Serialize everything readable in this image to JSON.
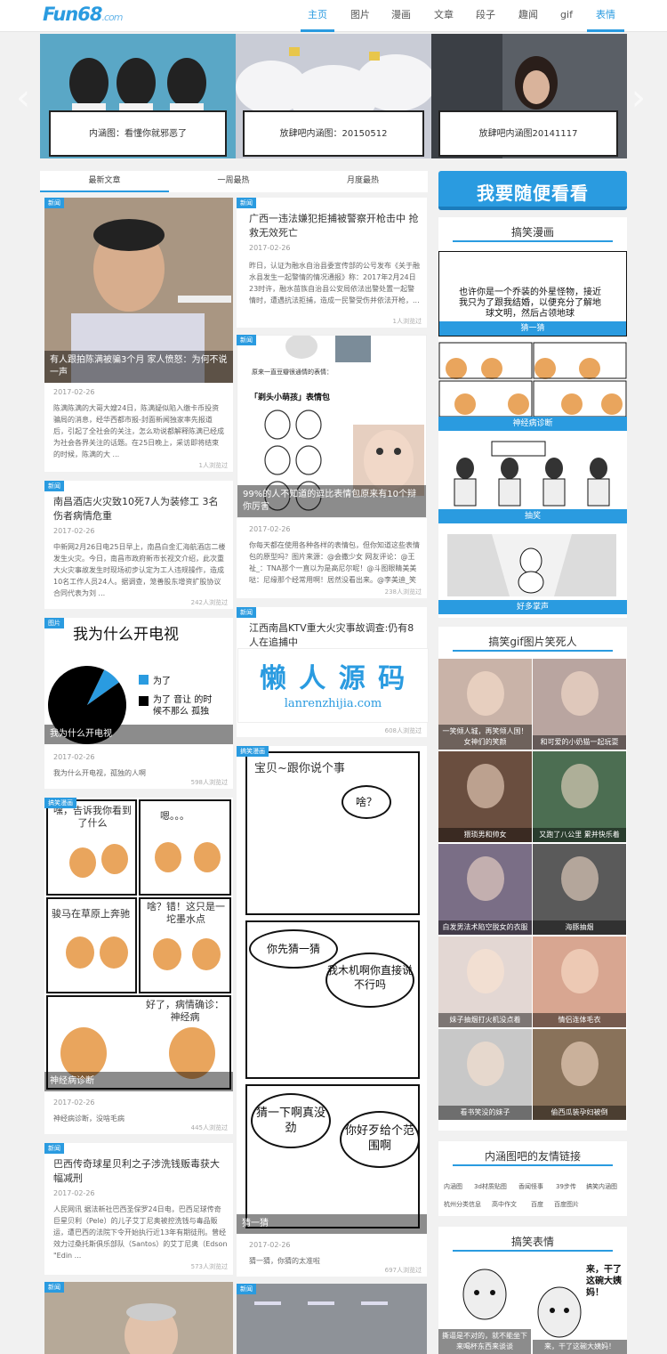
{
  "header": {
    "logo": "Fun68",
    "logo_suffix": ".com",
    "nav": [
      "主页",
      "图片",
      "漫画",
      "文章",
      "段子",
      "趣闻",
      "gif",
      "表情"
    ],
    "active_nav_index": 0
  },
  "slider": {
    "captions": [
      "内涵图：看懂你就邪恶了",
      "放肆吧内涵图：20150512",
      "放肆吧内涵图20141117"
    ]
  },
  "tabs": [
    "最新文章",
    "一周最热",
    "月度最热"
  ],
  "tag_news": "新闻",
  "tag_pic": "图片",
  "tag_comic": "搞笑漫画",
  "cards": {
    "c1": {
      "overlay": "有人跟拍陈满被骗3个月 家人愤怒：为何不说一声",
      "date": "2017-02-26",
      "body": "陈满陈满的大哥大嫂24日，陈满疑似陷入缴卡币投资骗局的消息，经华西都市报-封面新闻独家率先报道后，引起了全社会的关注，怎么劝说都解释陈满已经成为社会各界关注的话题。在25日晚上，采访即将结束的时候，陈满的大 ...",
      "views": "1人浏览过"
    },
    "c2": {
      "title": "广西一违法嫌犯拒捕被警察开枪击中 抢救无效死亡",
      "date": "2017-02-26",
      "body": "昨日，认证为融水自治县委宣传部的公号发布《关于融水县发生一起警情的情况通报》称：2017年2月24日23时许，融水苗族自治县公安局依法出警处置一起警情时，遭遇抗法拒捕，造成一民警受伤并依法开枪，...",
      "views": "1人浏览过"
    },
    "c3": {
      "title": "南昌酒店火灾致10死7人为装修工 3名伤者病情危重",
      "date": "2017-02-26",
      "body": "中新网2月26日电25日早上，南昌白金汇海航酒店二楼发生火灾。今日，南昌市政府新市长视文介绍，此次重大火灾事故发生时现场初步认定为工人违规操作，造成10名工作人员24人。据调查，笼善股东增资扩股协议合同代表为刘 ...",
      "views": "242人浏览过"
    },
    "c4": {
      "overlay": "99%的人不知道的逗比表情包原来有10个辩你厉害",
      "panel_head": "原来一直豆瓣很通情的表情：",
      "label": "「剃头小萌孩」表情包",
      "date": "2017-02-26",
      "body": "你每天都在使用各种各样的表情包，但你知道这些表情包的原型吗？图片来源：@会撒少女 网友评论：@王祉_：TNA那个一直以为是高尼尔呢！@斗图眼睛美美哒：尼缘那个经常用啊！居然没看出来。@李美迪_笑语 ...",
      "views": "238人浏览过"
    },
    "c5": {
      "title": "我为什么开电视",
      "legend1": "为了",
      "legend2": "为了 音让 的时候不那么 孤独",
      "overlay": "我为什么开电视",
      "date": "2017-02-26",
      "body": "我为什么开电视，孤独的人啊",
      "views": "598人浏览过"
    },
    "c6": {
      "title": "江西南昌KTV重大火灾事故调查:仍有8人在追捕中",
      "date": "2017-02-26",
      "views": "608人浏览过"
    },
    "c7": {
      "b1": "嘿，告诉我你看到了什么",
      "b2": "嗯。。。",
      "b3": "骏马在草原上奔驰",
      "b4": "啥？错！这只是一坨墨水点",
      "b5": "好了，病情确诊：神经病",
      "overlay": "神经病诊断",
      "date": "2017-02-26",
      "body": "神经病诊断，没啥毛病",
      "views": "445人浏览过"
    },
    "c8": {
      "b1": "宝贝~跟你说个事",
      "b2": "啥？",
      "b3": "你先猜一猜",
      "b4": "我木机啊你直接说不行吗",
      "b5": "猜一下啊真没劲",
      "b6": "你好歹给个范围啊",
      "overlay": "猜一猜",
      "date": "2017-02-26",
      "body": "猜一猜，你猜的太准啦",
      "views": "697人浏览过"
    },
    "c9": {
      "title": "巴西传奇球星贝利之子涉洗钱贩毒获大幅减刑",
      "date": "2017-02-26",
      "body": "人民网讯 据法新社巴西圣保罗24日电，巴西足球传奇巨星贝利（Pele）的儿子艾丁尼奥被控洗钱与毒品贩运，遭巴西的法院下令开始执行近13年有期徒刑。曾经效力过桑托斯俱乐部队（Santos）的艾丁尼奥（Edson \"Edin ...",
      "views": "573人浏览过"
    }
  },
  "sidebar": {
    "banner": "我要随便看看",
    "comic_title": "搞笑漫画",
    "comic_items": [
      "猜一猜",
      "神经病诊断",
      "抽奖",
      "好多掌声"
    ],
    "comic_bubble": "也许你是一个乔装的外星怪物，接近我只为了跟我结婚，以便充分了解地球文明，然后占领地球",
    "gif_title": "搞笑gif图片笑死人",
    "gifs": [
      "一笑倾人城，再笑倾人国！女神们的笑颜",
      "和可爱的小奶猫一起玩耍",
      "猥琐男和帅女",
      "又跑了八公里 累并快乐着",
      "白发男法术陷空脱女的衣服",
      "海豚抽烟",
      "妹子抽烟打火机没点着",
      "情侣连体毛衣",
      "看书笑没的妹子",
      "偷西瓜装孕妇被倒"
    ],
    "links_title": "内涵图吧的友情链接",
    "links": [
      "内涵图",
      "3d材质贴图",
      "香闻怪事",
      "39步传",
      "搞笑内涵图",
      "杭州分类信息",
      "高中作文",
      "百度",
      "百度图片"
    ],
    "emoji_title": "搞笑表情",
    "emoji_b1": "来，干了这碗大姨妈！",
    "emoji_cap1": "撕逼是不对的，就不能坐下来喝杯东西来谈谈",
    "emoji_cap2": "来，干了这碗大姨妈！"
  },
  "watermark": {
    "line1": "懒 人 源 码",
    "line2": "lanrenzhijia.com"
  },
  "colors": {
    "accent": "#2a9be0",
    "background": "#f1f1f1"
  },
  "chart_data": {
    "type": "pie",
    "title": "我为什么开电视",
    "categories": [
      "为了",
      "为了 音让 的时候不那么 孤独"
    ],
    "values": [
      8,
      92
    ]
  }
}
